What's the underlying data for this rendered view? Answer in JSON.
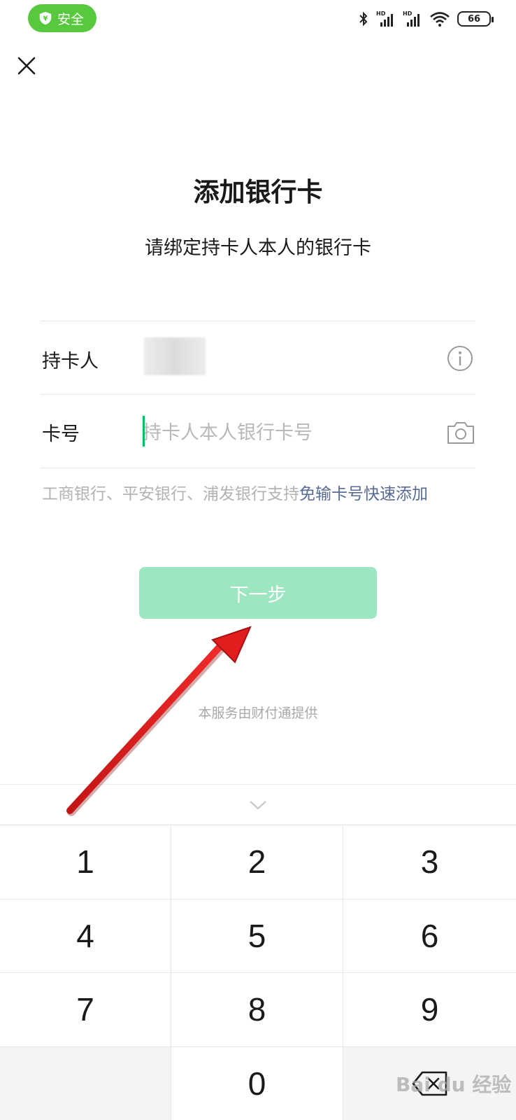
{
  "status_bar": {
    "badge_label": "安全",
    "battery": "66",
    "hd1": "HD",
    "hd2": "HD"
  },
  "page": {
    "title": "添加银行卡",
    "subtitle": "请绑定持卡人本人的银行卡"
  },
  "form": {
    "holder_label": "持卡人",
    "card_label": "卡号",
    "card_placeholder": "持卡人本人银行卡号"
  },
  "hint": {
    "text": "工商银行、平安银行、浦发银行支持",
    "link": "免输卡号快速添加"
  },
  "next_button": {
    "label": "下一步"
  },
  "service_note": "本服务由财付通提供",
  "keypad": {
    "keys": [
      "1",
      "2",
      "3",
      "4",
      "5",
      "6",
      "7",
      "8",
      "9",
      "",
      "0",
      "delete"
    ]
  },
  "colors": {
    "accent": "#07c160",
    "button_disabled": "#9ee6c0",
    "link": "#576b95",
    "badge": "#58c93e",
    "arrow": "#e11d1d"
  }
}
